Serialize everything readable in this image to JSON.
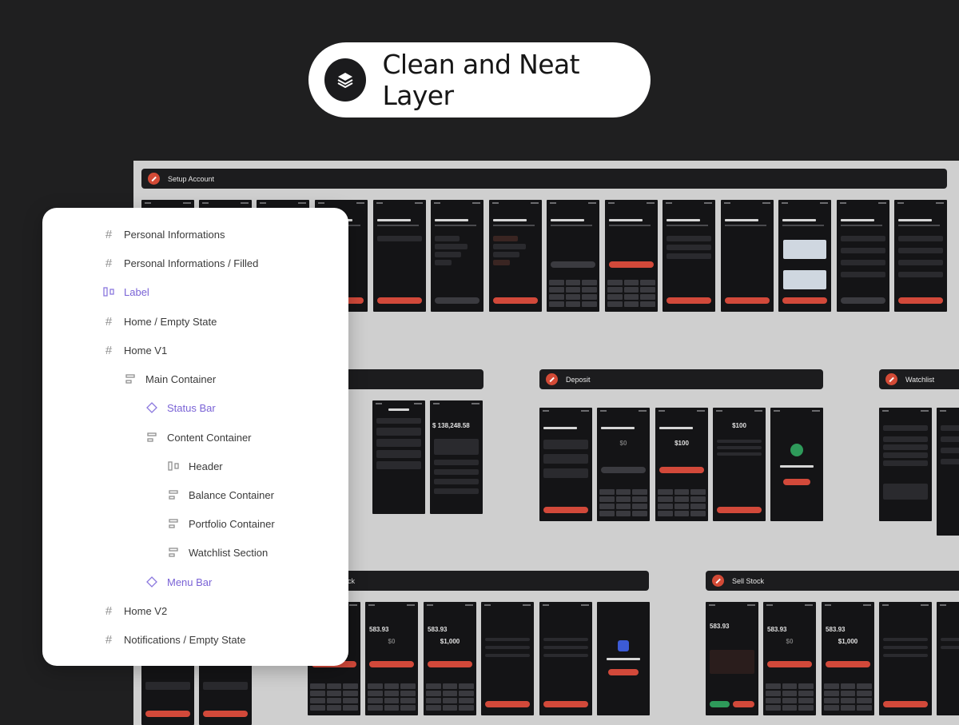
{
  "hero": {
    "title": "Clean and Neat Layer",
    "icon": "layers-icon"
  },
  "canvas": {
    "sections": [
      {
        "label": "Setup Account"
      },
      {
        "label": "Deposit"
      },
      {
        "label": "Watchlist"
      },
      {
        "label": "ck"
      },
      {
        "label": "Sell Stock"
      }
    ],
    "screens": {
      "balance_amount": "$ 138,248.58",
      "deposit_amount_1": "$0",
      "deposit_amount_2": "$100",
      "deposit_amount_3": "$100",
      "buy_amount_1": "$0",
      "buy_amount_2": "$1,000",
      "sell_amount_1": "$0",
      "sell_amount_2": "$1,000",
      "stock_price": "583.93"
    }
  },
  "layers": [
    {
      "label": "Personal Informations",
      "icon": "frame-hash-icon",
      "depth": 0,
      "accent": false
    },
    {
      "label": "Personal Informations / Filled",
      "icon": "frame-hash-icon",
      "depth": 0,
      "accent": false
    },
    {
      "label": "Label",
      "icon": "component-instance-icon",
      "depth": 0,
      "accent": true
    },
    {
      "label": "Home / Empty State",
      "icon": "frame-hash-icon",
      "depth": 0,
      "accent": false
    },
    {
      "label": "Home V1",
      "icon": "frame-hash-icon",
      "depth": 0,
      "accent": false
    },
    {
      "label": "Main Container",
      "icon": "auto-layout-icon",
      "depth": 1,
      "accent": false
    },
    {
      "label": "Status Bar",
      "icon": "component-diamond-icon",
      "depth": 2,
      "accent": true
    },
    {
      "label": "Content Container",
      "icon": "auto-layout-icon",
      "depth": 2,
      "accent": false
    },
    {
      "label": "Header",
      "icon": "component-instance-icon",
      "depth": 3,
      "accent": false
    },
    {
      "label": "Balance Container",
      "icon": "auto-layout-icon",
      "depth": 3,
      "accent": false
    },
    {
      "label": "Portfolio Container",
      "icon": "auto-layout-icon",
      "depth": 3,
      "accent": false
    },
    {
      "label": "Watchlist Section",
      "icon": "auto-layout-icon",
      "depth": 3,
      "accent": false
    },
    {
      "label": "Menu Bar",
      "icon": "component-diamond-icon",
      "depth": 2,
      "accent": true
    },
    {
      "label": "Home V2",
      "icon": "frame-hash-icon",
      "depth": 0,
      "accent": false
    },
    {
      "label": "Notifications / Empty State",
      "icon": "frame-hash-icon",
      "depth": 0,
      "accent": false
    }
  ],
  "colors": {
    "background": "#1f1f20",
    "canvas": "#cfcfcf",
    "accent_red": "#d2493a",
    "accent_purple": "#7a63d6"
  }
}
